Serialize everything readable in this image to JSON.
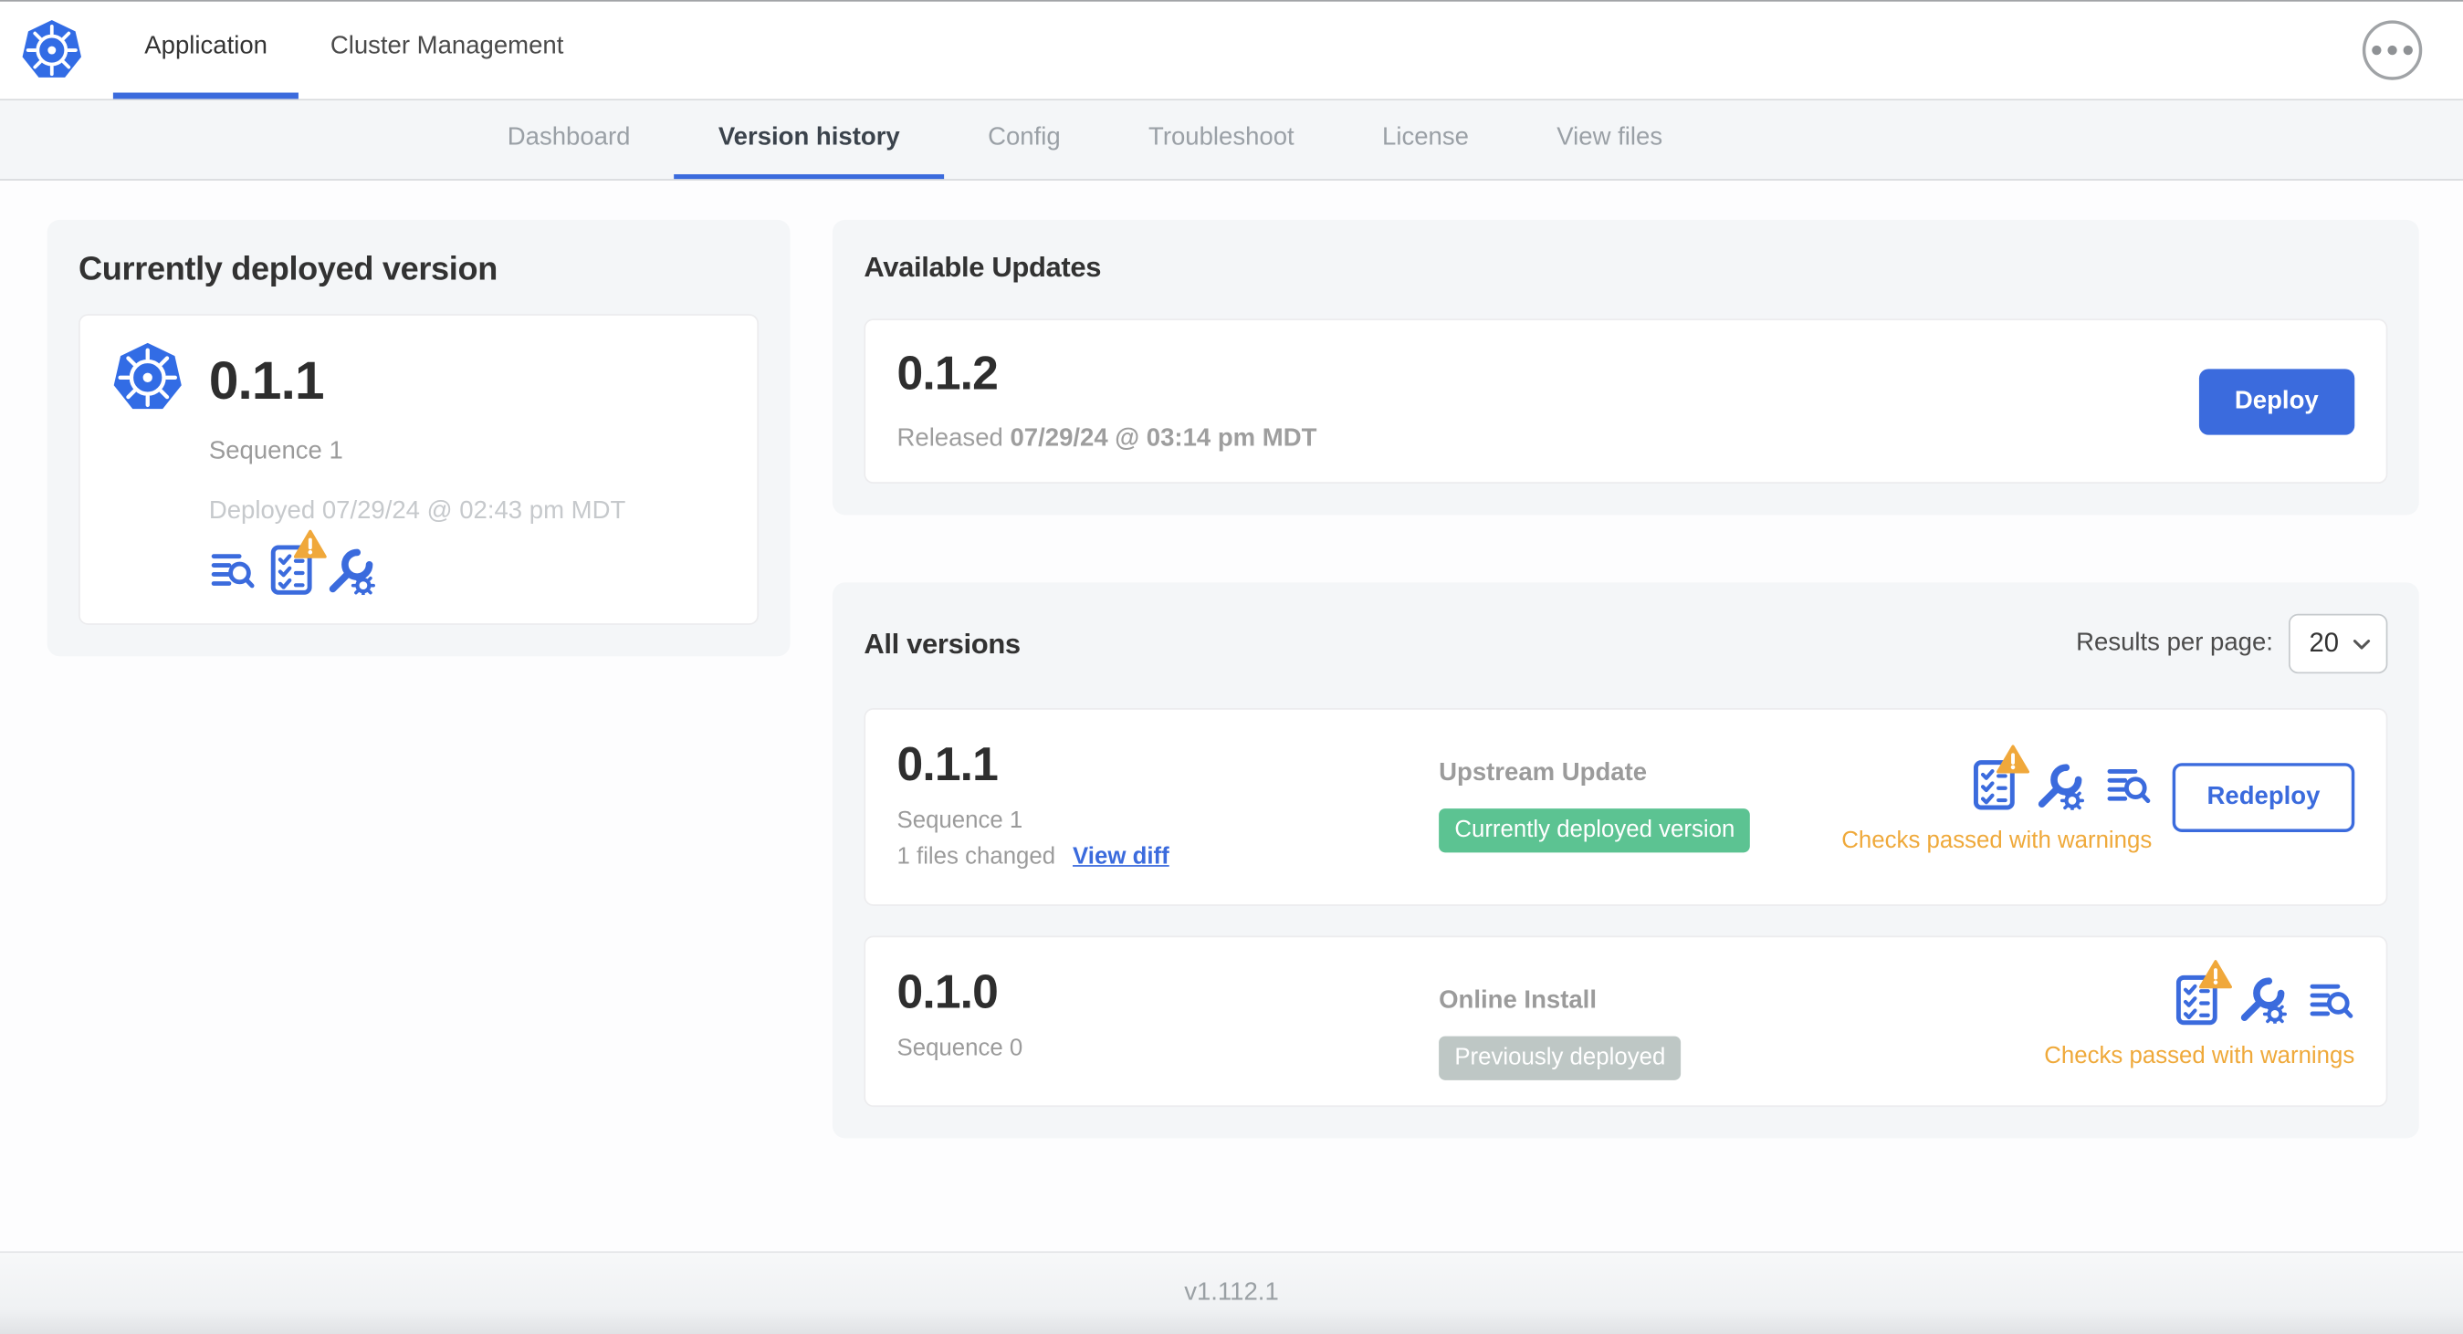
{
  "colors": {
    "primary_blue": "#3b6bdd",
    "kubernetes_blue": "#326ce5",
    "green_badge": "#5cc392",
    "gray_badge": "#bec7c5",
    "warning_amber": "#efa93a",
    "card_background": "#f4f6f8",
    "dark_text": "#323232",
    "gray_text": "#9b9b9b"
  },
  "header": {
    "tabs": [
      {
        "label": "Application",
        "active": true
      },
      {
        "label": "Cluster Management",
        "active": false
      }
    ]
  },
  "subnav": {
    "tabs": [
      {
        "label": "Dashboard",
        "active": false
      },
      {
        "label": "Version history",
        "active": true
      },
      {
        "label": "Config",
        "active": false
      },
      {
        "label": "Troubleshoot",
        "active": false
      },
      {
        "label": "License",
        "active": false
      },
      {
        "label": "View files",
        "active": false
      }
    ]
  },
  "current_version": {
    "title": "Currently deployed version",
    "version": "0.1.1",
    "sequence": "Sequence 1",
    "deployed": "Deployed 07/29/24 @ 02:43 pm MDT"
  },
  "available_updates": {
    "title": "Available Updates",
    "version": "0.1.2",
    "released_prefix": "Released",
    "released_date": "07/29/24 @ 03:14 pm MDT",
    "deploy_label": "Deploy"
  },
  "all_versions": {
    "title": "All versions",
    "results_per_page_label": "Results per page:",
    "results_per_page_value": "20",
    "rows": [
      {
        "version": "0.1.1",
        "sequence": "Sequence 1",
        "files_changed": "1 files changed",
        "view_diff_label": "View diff",
        "source": "Upstream Update",
        "badge": "Currently deployed version",
        "action_label": "Redeploy",
        "status": "Checks passed with warnings"
      },
      {
        "version": "0.1.0",
        "sequence": "Sequence 0",
        "source": "Online Install",
        "badge": "Previously deployed",
        "status": "Checks passed with warnings"
      }
    ]
  },
  "footer": {
    "app_version": "v1.112.1"
  },
  "icons": {
    "logo": "kubernetes-helm-wheel",
    "more": "ellipsis-in-circle",
    "deploy_logs": "lines-with-magnifier",
    "preflight_checks": "checklist-clipboard",
    "warning": "warning-triangle",
    "config": "wrench-with-gear",
    "select_chevron": "chevron-down"
  }
}
